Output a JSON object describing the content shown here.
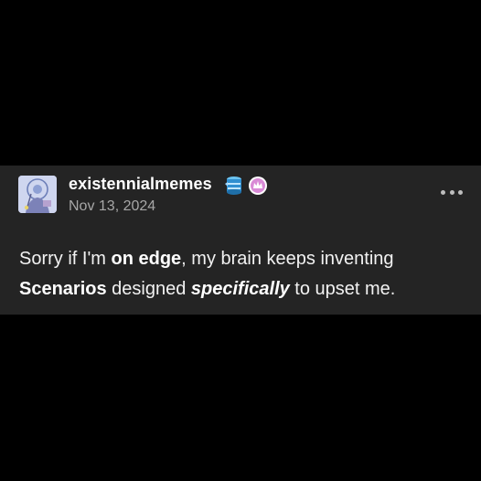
{
  "post": {
    "author": "existennialmemes",
    "date": "Nov 13, 2024",
    "body": {
      "text1": "Sorry if I'm ",
      "bold1": "on edge",
      "text2": ", my brain keeps inventing",
      "bold2": "Scenarios",
      "text3": " designed ",
      "emph1": "specifically",
      "text4": " to upset me."
    }
  },
  "icons": {
    "avatar": "avatar-image",
    "badge1": "blue-cylinder-badge-icon",
    "badge2": "pink-circle-badge-icon",
    "menu": "more-options-icon"
  },
  "colors": {
    "page_background": "#000000",
    "card_background": "#242424",
    "text_primary": "#ffffff",
    "text_secondary": "#a7a7a7",
    "badge_blue": "#3aa0e0",
    "badge_pink": "#d98ad6"
  }
}
